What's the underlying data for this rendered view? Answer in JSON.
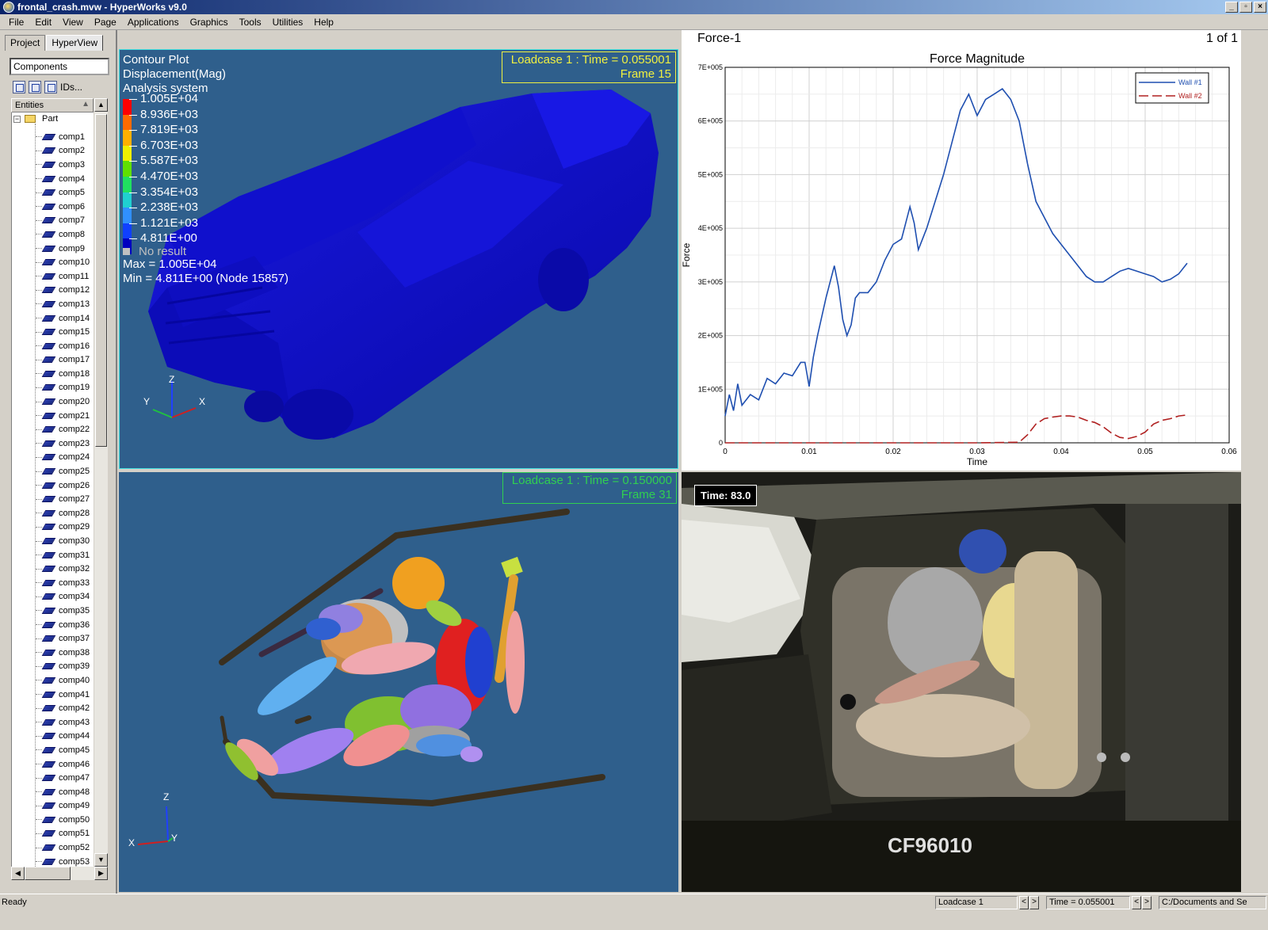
{
  "window": {
    "title": "frontal_crash.mvw - HyperWorks v9.0"
  },
  "menu": [
    "File",
    "Edit",
    "View",
    "Page",
    "Applications",
    "Graphics",
    "Tools",
    "Utilities",
    "Help"
  ],
  "left_panel": {
    "tabs": [
      "Project",
      "HyperView"
    ],
    "active_tab": "HyperView",
    "combo_value": "Components",
    "ids_label": "IDs...",
    "entities_header": "Entities",
    "tree_root": "Part",
    "components": [
      "comp1",
      "comp2",
      "comp3",
      "comp4",
      "comp5",
      "comp6",
      "comp7",
      "comp8",
      "comp9",
      "comp10",
      "comp11",
      "comp12",
      "comp13",
      "comp14",
      "comp15",
      "comp16",
      "comp17",
      "comp18",
      "comp19",
      "comp20",
      "comp21",
      "comp22",
      "comp23",
      "comp24",
      "comp25",
      "comp26",
      "comp27",
      "comp28",
      "comp29",
      "comp30",
      "comp31",
      "comp32",
      "comp33",
      "comp34",
      "comp35",
      "comp36",
      "comp37",
      "comp38",
      "comp39",
      "comp40",
      "comp41",
      "comp42",
      "comp43",
      "comp44",
      "comp45",
      "comp46",
      "comp47",
      "comp48",
      "comp49",
      "comp50",
      "comp51",
      "comp52",
      "comp53"
    ]
  },
  "contour_view": {
    "line1": "Contour Plot",
    "line2": "Displacement(Mag)",
    "line3": "Analysis system",
    "loadcase": "Loadcase 1 : Time = 0.055001",
    "frame": "Frame 15",
    "legend_values": [
      "1.005E+04",
      "8.936E+03",
      "7.819E+03",
      "6.703E+03",
      "5.587E+03",
      "4.470E+03",
      "3.354E+03",
      "2.238E+03",
      "1.121E+03",
      "4.811E+00"
    ],
    "legend_colors": [
      "#ff0000",
      "#ff6a00",
      "#ffb000",
      "#f0f000",
      "#60e000",
      "#20e060",
      "#20d0d0",
      "#3090ff",
      "#1040ff",
      "#0000c0"
    ],
    "no_result": "No result",
    "max": "Max = 1.005E+04",
    "min": "Min = 4.811E+00 (Node 15857)",
    "triad": {
      "z": "Z",
      "y": "Y",
      "x": "X"
    }
  },
  "dummy_view": {
    "loadcase": "Loadcase 1 : Time = 0.150000",
    "frame": "Frame 31",
    "triad": {
      "z": "Z",
      "y": "Y",
      "x": "X"
    }
  },
  "plot_view": {
    "header": "Force-1",
    "page": "1 of 1"
  },
  "chart_data": {
    "type": "line",
    "title": "Force Magnitude",
    "xlabel": "Time",
    "ylabel": "Force",
    "xlim": [
      0,
      0.06
    ],
    "ylim": [
      0,
      700000
    ],
    "x_ticks": [
      "0",
      "0.01",
      "0.02",
      "0.03",
      "0.04",
      "0.05",
      "0.06"
    ],
    "y_ticks": [
      "0",
      "1E+005",
      "2E+005",
      "3E+005",
      "4E+005",
      "5E+005",
      "6E+005",
      "7E+005"
    ],
    "grid": true,
    "legend_position": "top-right",
    "series": [
      {
        "name": "Wall #1",
        "color": "#1f4fb0",
        "dash": "solid",
        "x": [
          0,
          0.0005,
          0.001,
          0.0015,
          0.002,
          0.003,
          0.004,
          0.005,
          0.006,
          0.007,
          0.008,
          0.009,
          0.0095,
          0.01,
          0.0105,
          0.011,
          0.012,
          0.013,
          0.0135,
          0.014,
          0.0145,
          0.015,
          0.0155,
          0.016,
          0.017,
          0.018,
          0.019,
          0.02,
          0.021,
          0.022,
          0.0225,
          0.023,
          0.024,
          0.025,
          0.026,
          0.027,
          0.028,
          0.029,
          0.0295,
          0.03,
          0.031,
          0.032,
          0.033,
          0.034,
          0.035,
          0.0355,
          0.036,
          0.037,
          0.038,
          0.039,
          0.04,
          0.041,
          0.042,
          0.043,
          0.044,
          0.045,
          0.046,
          0.047,
          0.048,
          0.049,
          0.05,
          0.051,
          0.052,
          0.053,
          0.054,
          0.055
        ],
        "y": [
          50000,
          90000,
          60000,
          110000,
          70000,
          90000,
          80000,
          120000,
          110000,
          130000,
          125000,
          150000,
          150000,
          105000,
          160000,
          200000,
          270000,
          330000,
          290000,
          230000,
          200000,
          220000,
          270000,
          280000,
          280000,
          300000,
          340000,
          370000,
          380000,
          440000,
          410000,
          360000,
          400000,
          450000,
          500000,
          560000,
          620000,
          650000,
          630000,
          610000,
          640000,
          650000,
          660000,
          640000,
          600000,
          560000,
          520000,
          450000,
          420000,
          390000,
          370000,
          350000,
          330000,
          310000,
          300000,
          300000,
          310000,
          320000,
          325000,
          320000,
          315000,
          310000,
          300000,
          305000,
          315000,
          335000
        ]
      },
      {
        "name": "Wall #2",
        "color": "#b02020",
        "dash": "dashed",
        "x": [
          0,
          0.005,
          0.01,
          0.015,
          0.02,
          0.025,
          0.03,
          0.035,
          0.036,
          0.037,
          0.038,
          0.039,
          0.04,
          0.041,
          0.042,
          0.043,
          0.044,
          0.045,
          0.046,
          0.047,
          0.048,
          0.049,
          0.05,
          0.051,
          0.052,
          0.053,
          0.054,
          0.055
        ],
        "y": [
          0,
          0,
          0,
          0,
          0,
          0,
          0,
          1000,
          15000,
          35000,
          45000,
          48000,
          50000,
          50000,
          48000,
          42000,
          38000,
          30000,
          18000,
          10000,
          8000,
          12000,
          20000,
          35000,
          42000,
          45000,
          50000,
          52000
        ]
      }
    ]
  },
  "video_view": {
    "time_label": "Time:  83.0",
    "plate": "CF96010"
  },
  "statusbar": {
    "ready": "Ready",
    "loadcase": "Loadcase 1",
    "time": "Time = 0.055001",
    "path": "C:/Documents and Se"
  }
}
